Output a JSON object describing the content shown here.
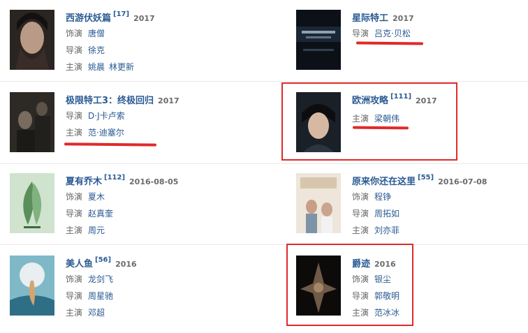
{
  "films": [
    {
      "title": "西游伏妖篇",
      "sup": "[17]",
      "year": "2017",
      "rows": [
        {
          "role": "饰演",
          "names": [
            "唐僧"
          ]
        },
        {
          "role": "导演",
          "names": [
            "徐克"
          ]
        },
        {
          "role": "主演",
          "names": [
            "姚晨",
            "林更新"
          ]
        }
      ]
    },
    {
      "title": "星际特工",
      "sup": "",
      "year": "2017",
      "rows": [
        {
          "role": "导演",
          "names": [
            "吕克·贝松"
          ]
        }
      ]
    },
    {
      "title": "极限特工3：终极回归",
      "sup": "",
      "year": "2017",
      "rows": [
        {
          "role": "导演",
          "names": [
            "D·J卡卢索"
          ]
        },
        {
          "role": "主演",
          "names": [
            "范·迪塞尔"
          ]
        }
      ]
    },
    {
      "title": "欧洲攻略",
      "sup": "[111]",
      "year": "2017",
      "rows": [
        {
          "role": "主演",
          "names": [
            "梁朝伟"
          ]
        }
      ]
    },
    {
      "title": "夏有乔木",
      "sup": "[112]",
      "year": "2016-08-05",
      "rows": [
        {
          "role": "饰演",
          "names": [
            "夏木"
          ]
        },
        {
          "role": "导演",
          "names": [
            "赵真奎"
          ]
        },
        {
          "role": "主演",
          "names": [
            "周元"
          ]
        }
      ]
    },
    {
      "title": "原来你还在这里",
      "sup": "[55]",
      "year": "2016-07-08",
      "rows": [
        {
          "role": "饰演",
          "names": [
            "程铮"
          ]
        },
        {
          "role": "导演",
          "names": [
            "周拓如"
          ]
        },
        {
          "role": "主演",
          "names": [
            "刘亦菲"
          ]
        }
      ]
    },
    {
      "title": "美人鱼",
      "sup": "[56]",
      "year": "2016",
      "rows": [
        {
          "role": "饰演",
          "names": [
            "龙剑飞"
          ]
        },
        {
          "role": "导演",
          "names": [
            "周星驰"
          ]
        },
        {
          "role": "主演",
          "names": [
            "邓超"
          ]
        }
      ]
    },
    {
      "title": "爵迹",
      "sup": "",
      "year": "2016",
      "rows": [
        {
          "role": "饰演",
          "names": [
            "银尘"
          ]
        },
        {
          "role": "导演",
          "names": [
            "郭敬明"
          ]
        },
        {
          "role": "主演",
          "names": [
            "范冰冰"
          ]
        }
      ]
    }
  ],
  "colors": {
    "link": "#2a5a93",
    "role": "#666666",
    "year": "#6b6b6b",
    "annotation": "#e02a2a"
  },
  "posters": [
    "portrait-dark",
    "sci-fi-title",
    "action-dark",
    "portrait-man",
    "green-poster",
    "romance-poster",
    "mermaid-moon",
    "dark-fantasy"
  ]
}
